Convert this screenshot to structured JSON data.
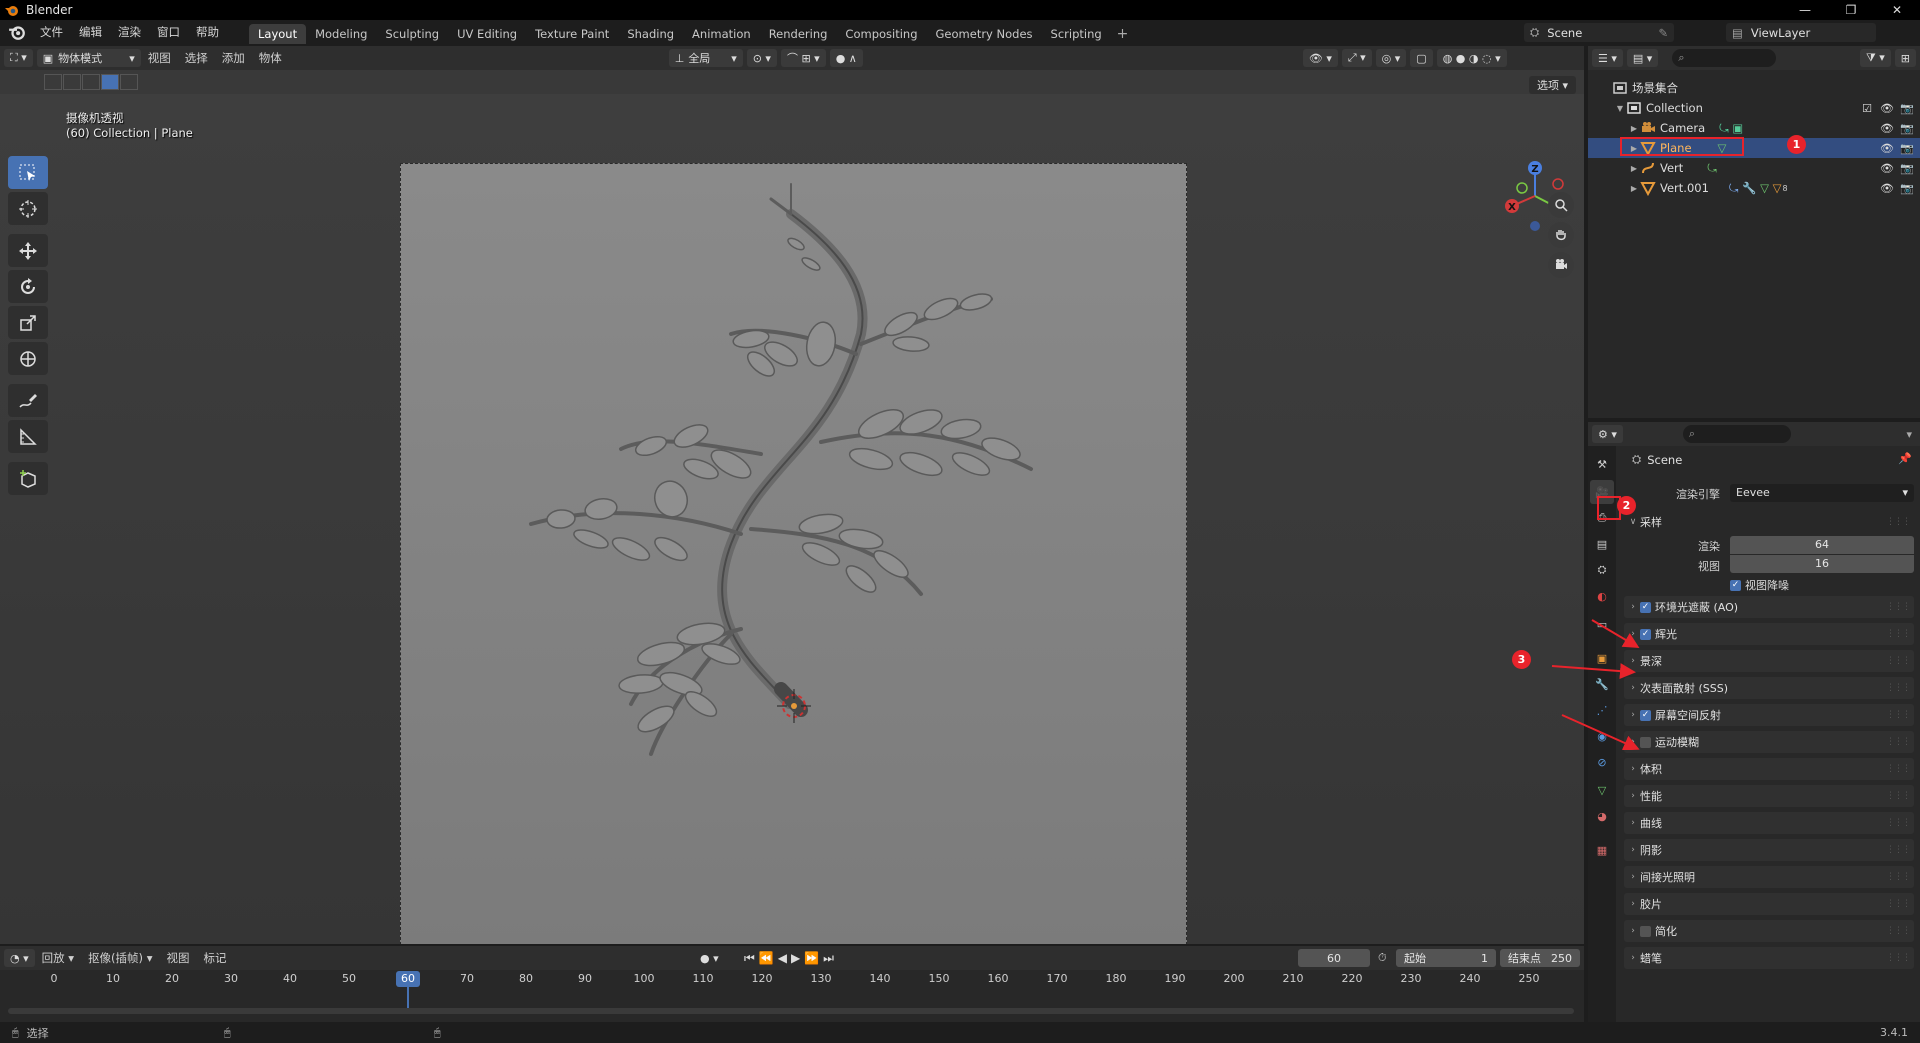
{
  "window": {
    "title": "Blender",
    "controls": [
      "—",
      "❐",
      "✕"
    ]
  },
  "menu": [
    "文件",
    "编辑",
    "渲染",
    "窗口",
    "帮助"
  ],
  "workspaces": [
    "Layout",
    "Modeling",
    "Sculpting",
    "UV Editing",
    "Texture Paint",
    "Shading",
    "Animation",
    "Rendering",
    "Compositing",
    "Geometry Nodes",
    "Scripting"
  ],
  "active_workspace": "Layout",
  "scene_name": "Scene",
  "view_layer": "ViewLayer",
  "viewport": {
    "mode": "物体模式",
    "menus": [
      "视图",
      "选择",
      "添加",
      "物体"
    ],
    "transform_orientation": "全局",
    "options_label": "选项",
    "info_line1": "摄像机透视",
    "info_line2": "(60) Collection | Plane",
    "gizmo": {
      "x": "X",
      "y": "Y",
      "z": "Z"
    }
  },
  "outliner": {
    "root": "场景集合",
    "collection": "Collection",
    "objects": [
      {
        "name": "Camera",
        "type": "camera"
      },
      {
        "name": "Plane",
        "type": "mesh",
        "selected": true
      },
      {
        "name": "Vert",
        "type": "curve"
      },
      {
        "name": "Vert.001",
        "type": "mesh",
        "badge": "8"
      }
    ]
  },
  "annotations": {
    "a1": "1",
    "a2": "2",
    "a3": "3"
  },
  "properties": {
    "scene_label": "Scene",
    "render_engine_label": "渲染引擎",
    "render_engine_value": "Eevee",
    "sampling_label": "采样",
    "render_label": "渲染",
    "render_value": "64",
    "viewport_label": "视图",
    "viewport_value": "16",
    "viewport_denoise": "视图降噪",
    "panels": [
      {
        "label": "环境光遮蔽 (AO)",
        "checkbox": true,
        "checked": true
      },
      {
        "label": "辉光",
        "checkbox": true,
        "checked": true
      },
      {
        "label": "景深",
        "checkbox": false
      },
      {
        "label": "次表面散射 (SSS)",
        "checkbox": false
      },
      {
        "label": "屏幕空间反射",
        "checkbox": true,
        "checked": true
      },
      {
        "label": "运动模糊",
        "checkbox": true,
        "checked": false
      },
      {
        "label": "体积",
        "checkbox": false
      },
      {
        "label": "性能",
        "checkbox": false
      },
      {
        "label": "曲线",
        "checkbox": false
      },
      {
        "label": "阴影",
        "checkbox": false
      },
      {
        "label": "间接光照明",
        "checkbox": false
      },
      {
        "label": "胶片",
        "checkbox": false
      },
      {
        "label": "简化",
        "checkbox": true,
        "checked": false
      },
      {
        "label": "蜡笔",
        "checkbox": false
      }
    ]
  },
  "timeline": {
    "playback": "回放",
    "keying": "抠像(插帧)",
    "view": "视图",
    "marker": "标记",
    "current_frame": "60",
    "start_label": "起始",
    "start_value": "1",
    "end_label": "结束点",
    "end_value": "250",
    "ticks": [
      "0",
      "10",
      "20",
      "30",
      "40",
      "50",
      "60",
      "70",
      "80",
      "90",
      "100",
      "110",
      "120",
      "130",
      "140",
      "150",
      "160",
      "170",
      "180",
      "190",
      "200",
      "210",
      "220",
      "230",
      "240",
      "250"
    ]
  },
  "status": {
    "select_label": "选择",
    "version": "3.4.1"
  },
  "colors": {
    "accent": "#4772b3",
    "annotation": "#e8232b",
    "selected_row": "#334d80"
  }
}
